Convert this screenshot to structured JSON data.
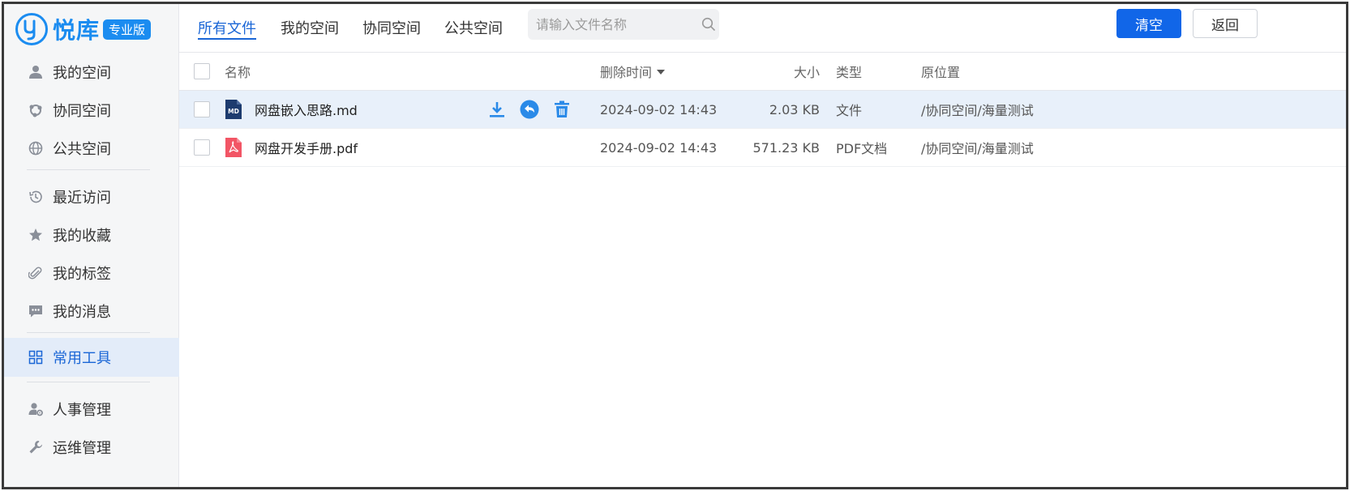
{
  "brand": {
    "logo_char": "y",
    "name": "悦库",
    "badge": "专业版",
    "accent": "#1b8cf0"
  },
  "sidebar": {
    "items": [
      {
        "label": "我的空间",
        "icon": "user-icon"
      },
      {
        "label": "协同空间",
        "icon": "share-nodes-icon"
      },
      {
        "label": "公共空间",
        "icon": "globe-icon"
      },
      {
        "label": "最近访问",
        "icon": "history-icon"
      },
      {
        "label": "我的收藏",
        "icon": "star-icon"
      },
      {
        "label": "我的标签",
        "icon": "paperclip-icon"
      },
      {
        "label": "我的消息",
        "icon": "message-icon"
      },
      {
        "label": "常用工具",
        "icon": "grid-icon",
        "active": true
      },
      {
        "label": "人事管理",
        "icon": "user-gear-icon"
      },
      {
        "label": "运维管理",
        "icon": "wrench-icon"
      }
    ]
  },
  "topbar": {
    "tabs": [
      {
        "label": "所有文件",
        "active": true
      },
      {
        "label": "我的空间"
      },
      {
        "label": "协同空间"
      },
      {
        "label": "公共空间"
      }
    ],
    "search_placeholder": "请输入文件名称",
    "clear_label": "清空",
    "back_label": "返回"
  },
  "table": {
    "columns": {
      "name": "名称",
      "deleted_time": "删除时间",
      "size": "大小",
      "type": "类型",
      "location": "原位置"
    },
    "rows": [
      {
        "name": "网盘嵌入思路.md",
        "icon_text": "MD",
        "icon": "markdown-file-icon",
        "time": "2024-09-02 14:43",
        "size": "2.03 KB",
        "type": "文件",
        "location": "/协同空间/海量测试"
      },
      {
        "name": "网盘开发手册.pdf",
        "icon": "pdf-file-icon",
        "time": "2024-09-02 14:43",
        "size": "571.23 KB",
        "type": "PDF文档",
        "location": "/协同空间/海量测试"
      }
    ]
  },
  "colors": {
    "primary": "#1166e8",
    "active_text": "#1a66d6",
    "hover_row": "#e8f0fa",
    "pdf_red": "#f25565",
    "md_navy": "#1d3b6e"
  }
}
